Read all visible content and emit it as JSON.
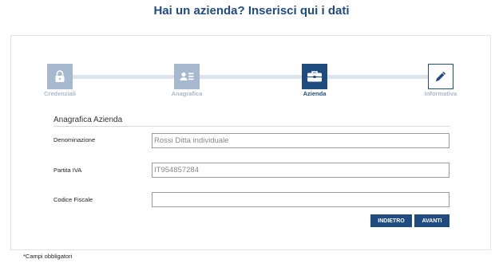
{
  "page": {
    "title": "Hai un azienda? Inserisci qui i dati",
    "footnote": "*Campi obbligatori"
  },
  "stepper": {
    "steps": [
      {
        "label": "Credenziali",
        "state": "done",
        "icon": "lock-icon"
      },
      {
        "label": "Anagrafica",
        "state": "done",
        "icon": "id-card-icon"
      },
      {
        "label": "Azienda",
        "state": "active",
        "icon": "briefcase-icon"
      },
      {
        "label": "Informativa",
        "state": "todo",
        "icon": "pencil-icon"
      }
    ]
  },
  "form": {
    "section_title": "Anagrafica Azienda",
    "fields": {
      "denominazione": {
        "label": "Denominazione",
        "value": "Rossi Ditta individuale"
      },
      "partita_iva": {
        "label": "Partita IVA",
        "value": "IT954857284"
      },
      "codice_fiscale": {
        "label": "Codice Fiscale",
        "value": ""
      }
    },
    "buttons": {
      "back": "INDIETRO",
      "next": "AVANTI"
    }
  },
  "colors": {
    "primary": "#1f4b80",
    "step_done": "#a7b9d0",
    "track": "#dde4ec"
  }
}
